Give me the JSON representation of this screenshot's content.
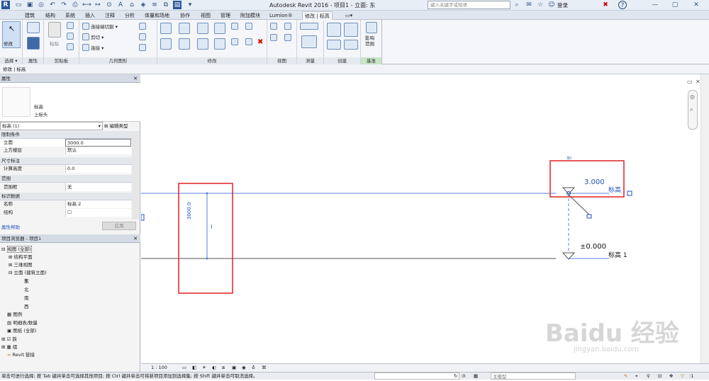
{
  "app": {
    "title": "Autodesk Revit 2016 -  项目1 - 立面: 东",
    "search_placeholder": "键入关键字或短语",
    "login_label": "登录",
    "help_label": "?"
  },
  "tabs": [
    "建筑",
    "结构",
    "系统",
    "插入",
    "注释",
    "分析",
    "体量和场地",
    "协作",
    "视图",
    "管理",
    "附加模块",
    "Lumion®",
    "修改 | 标高"
  ],
  "active_tab_index": 12,
  "ribbon": {
    "groups": [
      "选择",
      "属性",
      "剪贴板",
      "几何图形",
      "修改",
      "视图",
      "测量",
      "创建",
      "基准"
    ],
    "select_label": "选择 ▾",
    "modify_label": "修改",
    "paste_label": "粘贴",
    "cut_join_label": "连接端切割 ▾",
    "cut_label": "剪切 ▾",
    "join_label": "连接 ▾",
    "affect_range_label": "影响\n范围"
  },
  "context_bar": "修改 | 标高",
  "properties": {
    "header": "属性",
    "type_name": "标高",
    "type_sub": "上标头",
    "selector_value": "标高 (1)",
    "edit_type_label": "编辑类型",
    "categories": {
      "constraints": "限制条件",
      "dimensions": "尺寸标注",
      "extents": "范围",
      "identity": "标识数据"
    },
    "rows": {
      "elevation_key": "立面",
      "elevation_val": "3000.0",
      "story_above_key": "上方楼层",
      "story_above_val": "默认",
      "computed_height_key": "计算高度",
      "computed_height_val": "0.0",
      "scope_box_key": "范围框",
      "scope_box_val": "无",
      "name_key": "名称",
      "name_val": "标高 2",
      "structural_key": "结构"
    },
    "help_link": "属性帮助",
    "apply_label": "应用"
  },
  "project_browser": {
    "header": "项目浏览器 - 项目1",
    "items": [
      "视图 (全部)",
      "结构平面",
      "三维视图",
      "立面 (建筑立面)",
      "东",
      "北",
      "南",
      "西",
      "图例",
      "明细表/数量",
      "图纸 (全部)",
      "族",
      "组",
      "Revit 链接"
    ]
  },
  "canvas": {
    "level_upper_value": "3.000",
    "level_upper_name": "标高",
    "level_lower_value": "±0.000",
    "level_lower_name": "标高 1",
    "dimension_value": "3000.0",
    "watermark_text": "Baidu 经验",
    "watermark_sub": "jingyan.baidu.com"
  },
  "view_bar": {
    "scale": "1 : 100"
  },
  "status_bar": {
    "message": "单击可进行选择; 按 Tab 键并单击可选择其他项目; 按 Ctrl 键并单击可将新项目添加到选择集; 按 Shift 键并单击可取消选择。",
    "coord_readout": ":0",
    "model_label": "主模型"
  },
  "colors": {
    "accent_blue": "#3a6fd1",
    "highlight_red": "#e02020",
    "level_line": "#5a7fe0",
    "lower_level_line": "#555555"
  }
}
